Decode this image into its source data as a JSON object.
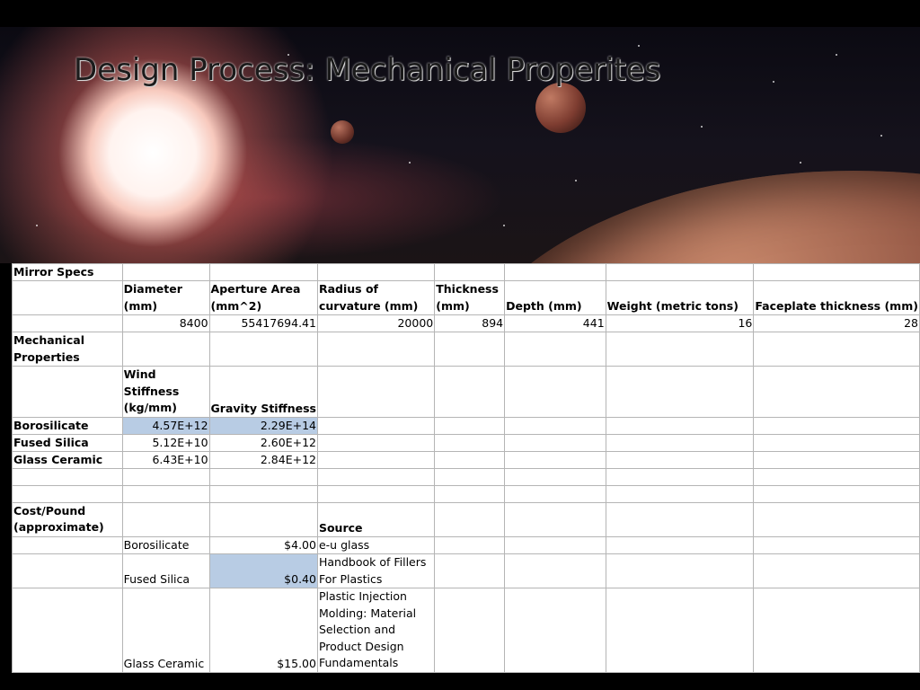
{
  "slide": {
    "title": "Design Process: Mechanical Properites"
  },
  "spreadsheet": {
    "mirror_specs": {
      "section_label": "Mirror Specs",
      "headers": [
        "Diameter (mm)",
        "Aperture Area (mm^2)",
        "Radius of curvature (mm)",
        "Thickness (mm)",
        "Depth (mm)",
        "Weight (metric tons)",
        "Faceplate thickness (mm)"
      ],
      "values": [
        "8400",
        "55417694.41",
        "20000",
        "894",
        "441",
        "16",
        "28"
      ]
    },
    "mechanical": {
      "section_label": "Mechanical Properties",
      "headers": [
        "Wind Stiffness (kg/mm)",
        "Gravity Stiffness"
      ],
      "rows": [
        {
          "material": "Borosilicate",
          "wind": "4.57E+12",
          "gravity": "2.29E+14"
        },
        {
          "material": "Fused Silica",
          "wind": "5.12E+10",
          "gravity": "2.60E+12"
        },
        {
          "material": "Glass Ceramic",
          "wind": "6.43E+10",
          "gravity": "2.84E+12"
        }
      ]
    },
    "cost": {
      "section_label": "Cost/Pound (approximate)",
      "source_header": "Source",
      "rows": [
        {
          "material": "Borosilicate",
          "price": "$4.00",
          "source": "e-u glass"
        },
        {
          "material": "Fused Silica",
          "price": "$0.40",
          "source": "Handbook of Fillers For Plastics"
        },
        {
          "material": "Glass Ceramic",
          "price": "$15.00",
          "source": "Plastic Injection Molding: Material Selection and Product Design Fundamentals"
        }
      ]
    },
    "highlight_color": "#b8cce4"
  },
  "background": {
    "theme": "space-nebula",
    "colors": {
      "sky": "#15121c",
      "sun": "#fff3ef",
      "planet": "#9b5e4a"
    }
  }
}
